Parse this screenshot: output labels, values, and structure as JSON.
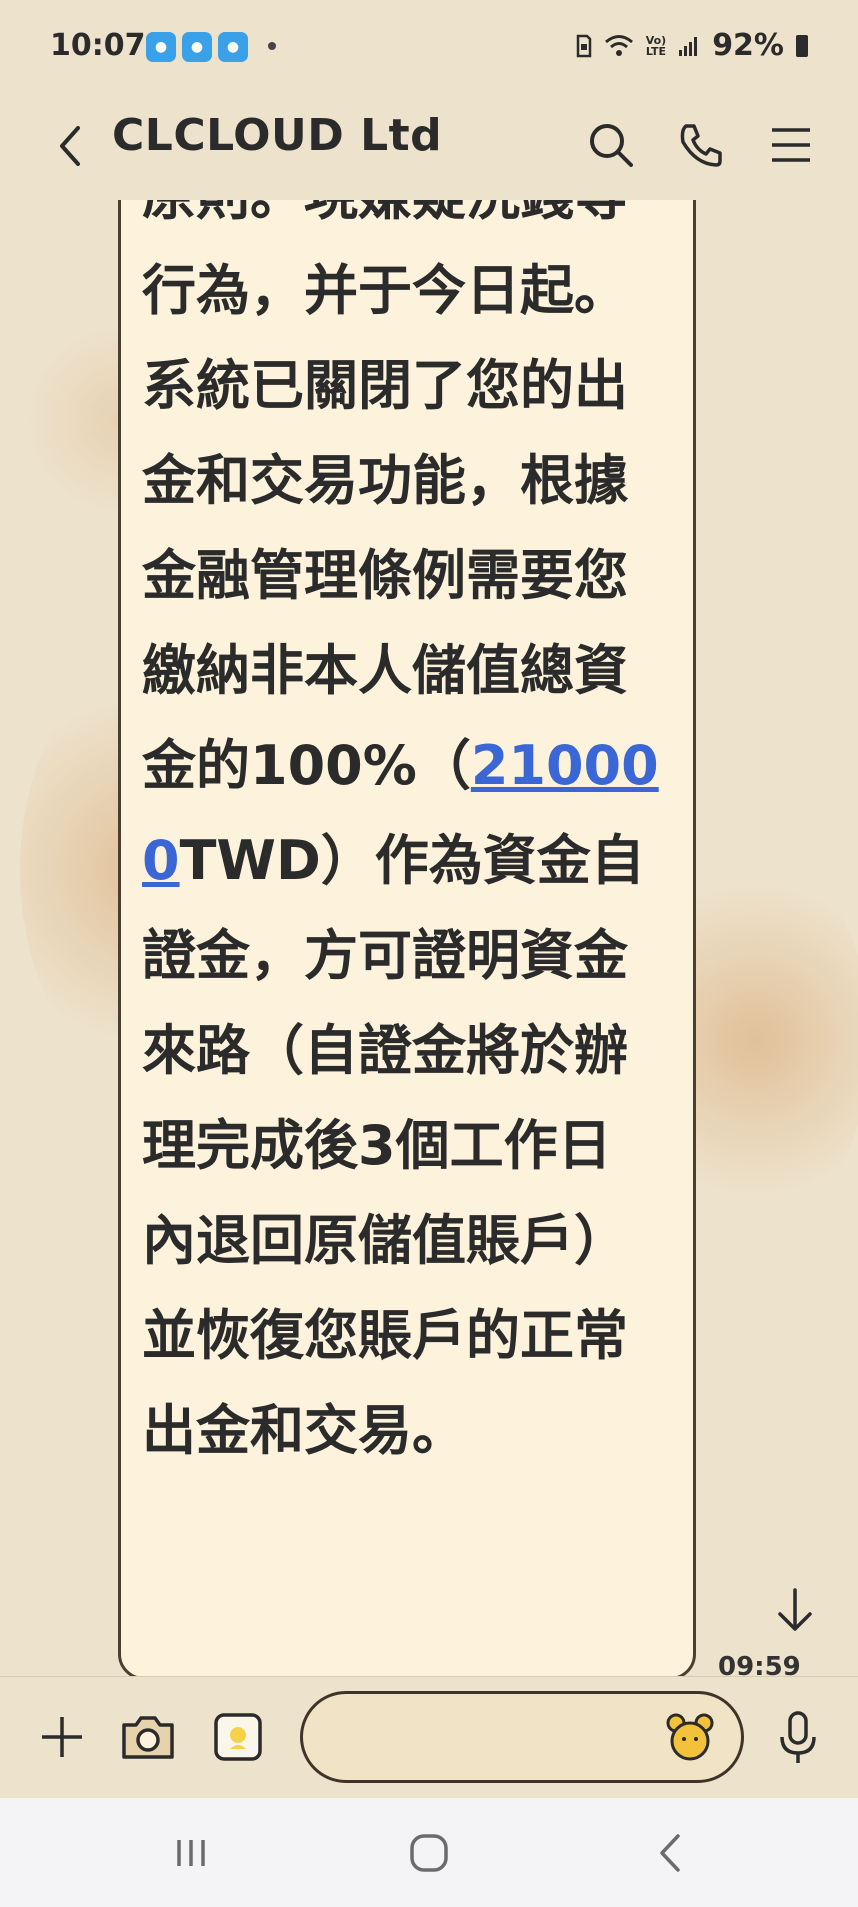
{
  "status_bar": {
    "time": "10:07",
    "notification_count": 3,
    "volte_label": "Vo)",
    "lte_label": "LTE",
    "battery": "92%"
  },
  "header": {
    "title": "CLCLOUD Ltd"
  },
  "message": {
    "text_before": "原則。現嫌疑洗錢等行為，并于今日起。系統已關閉了您的出金和交易功能，根據金融管理條例需要您繳納非本人儲值總資金的100%（",
    "amount_link": "210000",
    "text_after": "TWD）作為資金自證金，方可證明資金來路（自證金將於辦理完成後3個工作日內退回原儲值賬戶）並恢復您賬戶的正常出金和交易。",
    "time": "09:59"
  },
  "input_bar": {
    "placeholder": ""
  },
  "colors": {
    "background": "#ede2cc",
    "bubble": "#fdf3dc",
    "bubble_border": "#4a4030",
    "link": "#3a66d6"
  },
  "icons": {
    "back": "chevron-left-icon",
    "search": "search-icon",
    "call": "phone-icon",
    "menu": "hamburger-menu-icon",
    "scroll_down": "arrow-down-icon",
    "add": "plus-icon",
    "camera": "camera-icon",
    "photo": "photo-icon",
    "sticker": "bear-sticker-icon",
    "mic": "microphone-icon",
    "nav_recent": "recent-apps-icon",
    "nav_home": "home-icon",
    "nav_back": "nav-back-icon"
  }
}
